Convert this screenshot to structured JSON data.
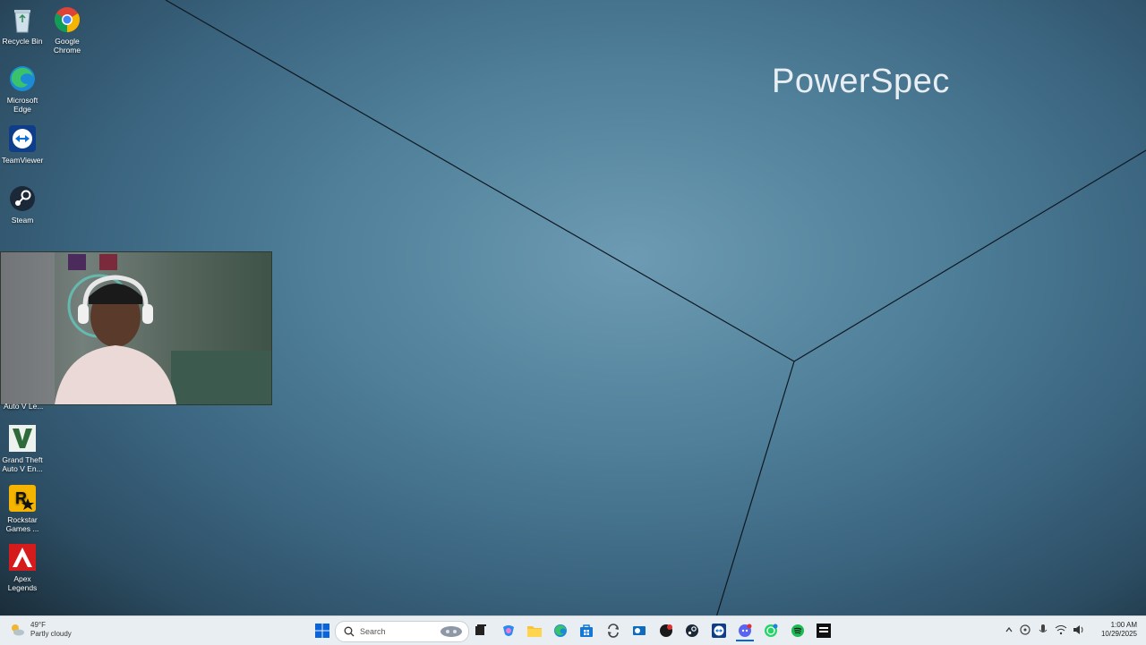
{
  "wallpaper": {
    "brand_text": "PowerSpec"
  },
  "desktop_icons": [
    {
      "name": "recycle-bin",
      "label": "Recycle Bin"
    },
    {
      "name": "google-chrome",
      "label": "Google Chrome"
    },
    {
      "name": "microsoft-edge",
      "label": "Microsoft Edge"
    },
    {
      "name": "teamviewer",
      "label": "TeamViewer"
    },
    {
      "name": "steam",
      "label": "Steam"
    },
    {
      "name": "gta-legacy",
      "label": "Auto V Le..."
    },
    {
      "name": "gta-enhanced",
      "label": "Grand Theft Auto V En..."
    },
    {
      "name": "rockstar-games",
      "label": "Rockstar Games ..."
    },
    {
      "name": "apex-legends",
      "label": "Apex Legends"
    }
  ],
  "taskbar": {
    "weather": {
      "temp": "49°F",
      "condition": "Partly cloudy"
    },
    "search_placeholder": "Search",
    "clock": {
      "time": "1:00 AM",
      "date": "10/29/2025"
    },
    "colors": {
      "accent": "#0a64d8",
      "background": "#e9eef2"
    }
  }
}
